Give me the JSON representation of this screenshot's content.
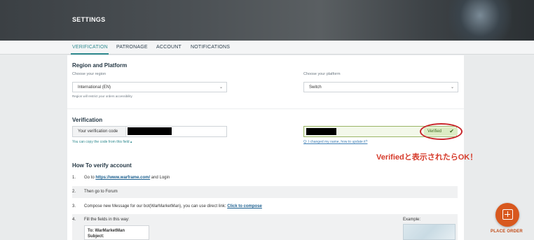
{
  "header": {
    "title": "SETTINGS"
  },
  "tabs": [
    {
      "label": "VERIFICATION",
      "active": true
    },
    {
      "label": "PATRONAGE",
      "active": false
    },
    {
      "label": "ACCOUNT",
      "active": false
    },
    {
      "label": "NOTIFICATIONS",
      "active": false
    }
  ],
  "region": {
    "heading": "Region and Platform",
    "region_label": "Choose your region",
    "region_value": "International (EN)",
    "region_note": "Region will restrict your orders accessibility",
    "platform_label": "Choose your platform",
    "platform_value": "Switch"
  },
  "verification": {
    "heading": "Verification",
    "code_label": "Your verification code",
    "copy_hint": "You can copy the code from this field",
    "status": "Verified",
    "name_help": "Q: I changed my name, how to update it?",
    "annotation": "Verifiedと表示されたらOK！"
  },
  "howto": {
    "heading": "How To verify account",
    "steps": [
      {
        "num": "1.",
        "pre": "Go to ",
        "link": "https://www.warframe.com/",
        "post": " and Login"
      },
      {
        "num": "2.",
        "pre": "Then go to Forum",
        "link": "",
        "post": ""
      },
      {
        "num": "3.",
        "pre": "Compose new Message for our bot(WarMarketMan), you can use direct link: ",
        "link": "Click to compose",
        "post": ""
      },
      {
        "num": "4.",
        "pre": "Fill the fields in this way:",
        "link": "",
        "post": ""
      }
    ],
    "mail_to": "To: WarMarketMan",
    "mail_subject": "Subject:",
    "example_label": "Example:"
  },
  "fab": {
    "label": "PLACE ORDER"
  },
  "colors": {
    "accent": "#2f8a8f",
    "fab": "#d8581e",
    "verified": "#3d6a1f",
    "annotation": "#d63a2a"
  }
}
